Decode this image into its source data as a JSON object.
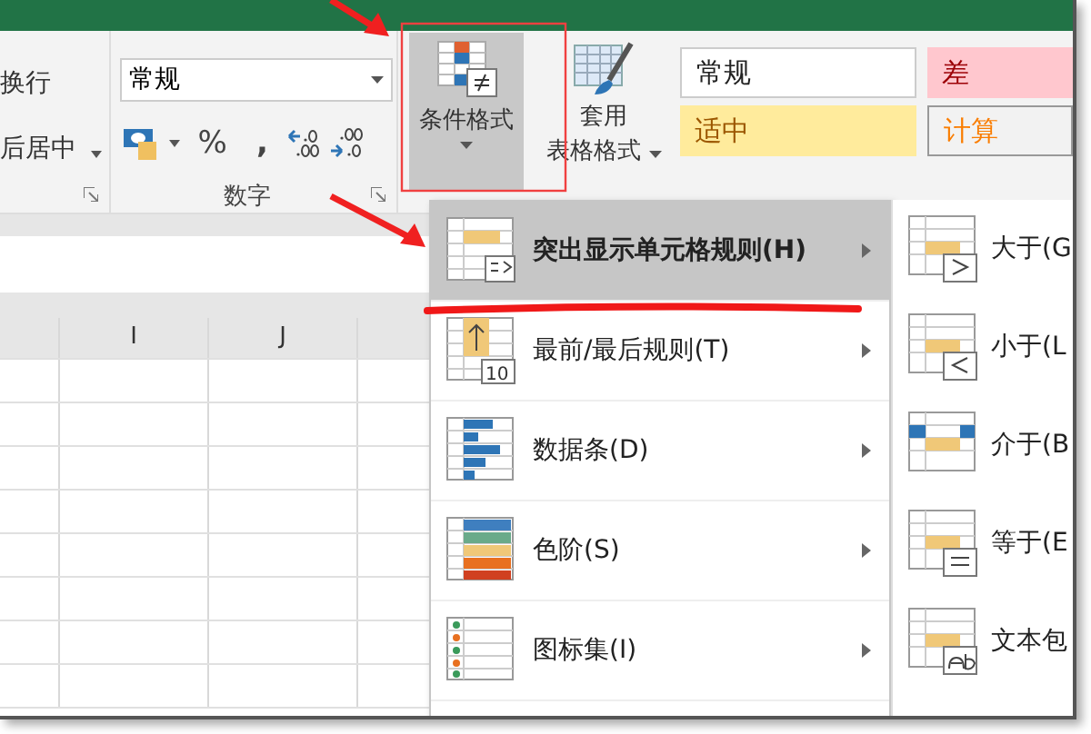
{
  "alignment_group": {
    "wrap_text": "换行",
    "merge_center": "后居中"
  },
  "number_group": {
    "format_field": {
      "value": "常规"
    },
    "percent": "%",
    "comma": ",",
    "label": "数字"
  },
  "conditional_format": {
    "label": "条件格式",
    "selected": true
  },
  "table_format": {
    "line1": "套用",
    "line2": "表格格式"
  },
  "cell_styles": [
    {
      "label": "常规",
      "kind": "normal"
    },
    {
      "label": "差",
      "kind": "bad"
    },
    {
      "label": "适中",
      "kind": "neutral"
    },
    {
      "label": "计算",
      "kind": "calculation"
    }
  ],
  "sheet": {
    "columns": [
      {
        "label": "I"
      },
      {
        "label": "J"
      }
    ]
  },
  "menu": {
    "items": [
      {
        "label": "突出显示单元格规则(H)",
        "kind": "highlight",
        "selected": true
      },
      {
        "label": "最前/最后规则(T)",
        "kind": "top",
        "selected": false,
        "icon_text": "10"
      },
      {
        "label": "数据条(D)",
        "kind": "databar",
        "selected": false
      },
      {
        "label": "色阶(S)",
        "kind": "colorscale",
        "selected": false
      },
      {
        "label": "图标集(I)",
        "kind": "iconset",
        "selected": false
      }
    ]
  },
  "submenu": {
    "items": [
      {
        "label": "大于(G",
        "kind": "greater"
      },
      {
        "label": "小于(L",
        "kind": "less"
      },
      {
        "label": "介于(B",
        "kind": "between"
      },
      {
        "label": "等于(E",
        "kind": "equal"
      },
      {
        "label": "文本包",
        "kind": "text"
      }
    ]
  },
  "annotations": [
    {
      "kind": "arrow"
    },
    {
      "kind": "box"
    },
    {
      "kind": "arrow"
    },
    {
      "kind": "underline"
    }
  ]
}
